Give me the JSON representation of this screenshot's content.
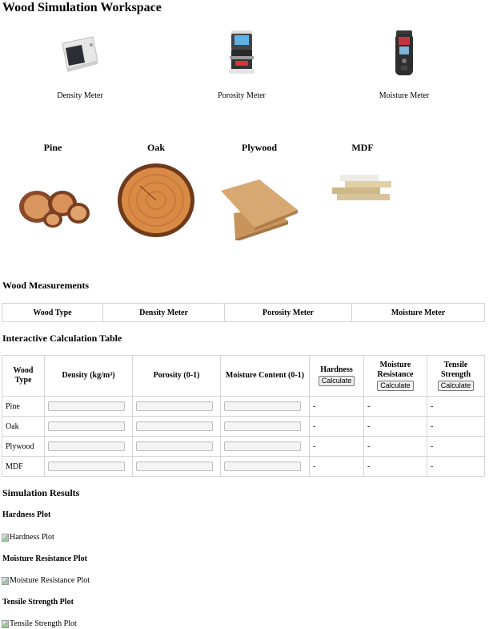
{
  "title": "Wood Simulation Workspace",
  "instruments": [
    {
      "label": "Density Meter",
      "icon": "density-meter-device-icon"
    },
    {
      "label": "Porosity Meter",
      "icon": "porosity-meter-device-icon"
    },
    {
      "label": "Moisture Meter",
      "icon": "moisture-meter-device-icon"
    }
  ],
  "woods": [
    {
      "name": "Pine",
      "icon": "pine-logs-image"
    },
    {
      "name": "Oak",
      "icon": "oak-slice-image"
    },
    {
      "name": "Plywood",
      "icon": "plywood-sheets-image"
    },
    {
      "name": "MDF",
      "icon": "mdf-boards-image"
    }
  ],
  "measurements": {
    "heading": "Wood Measurements",
    "columns": [
      "Wood Type",
      "Density Meter",
      "Porosity Meter",
      "Moisture Meter"
    ]
  },
  "calc": {
    "heading": "Interactive Calculation Table",
    "columns": [
      "Wood Type",
      "Density (kg/m³)",
      "Porosity (0-1)",
      "Moisture Content (0-1)",
      "Hardness",
      "Moisture Resistance",
      "Tensile Strength"
    ],
    "calculate_label": "Calculate",
    "rows": [
      {
        "type": "Pine",
        "hardness": "-",
        "moisture_resistance": "-",
        "tensile": "-"
      },
      {
        "type": "Oak",
        "hardness": "-",
        "moisture_resistance": "-",
        "tensile": "-"
      },
      {
        "type": "Plywood",
        "hardness": "-",
        "moisture_resistance": "-",
        "tensile": "-"
      },
      {
        "type": "MDF",
        "hardness": "-",
        "moisture_resistance": "-",
        "tensile": "-"
      }
    ]
  },
  "results": {
    "heading": "Simulation Results",
    "plots": [
      {
        "heading": "Hardness Plot",
        "alt": "Hardness Plot"
      },
      {
        "heading": "Moisture Resistance Plot",
        "alt": "Moisture Resistance Plot"
      },
      {
        "heading": "Tensile Strength Plot",
        "alt": "Tensile Strength Plot"
      }
    ]
  }
}
